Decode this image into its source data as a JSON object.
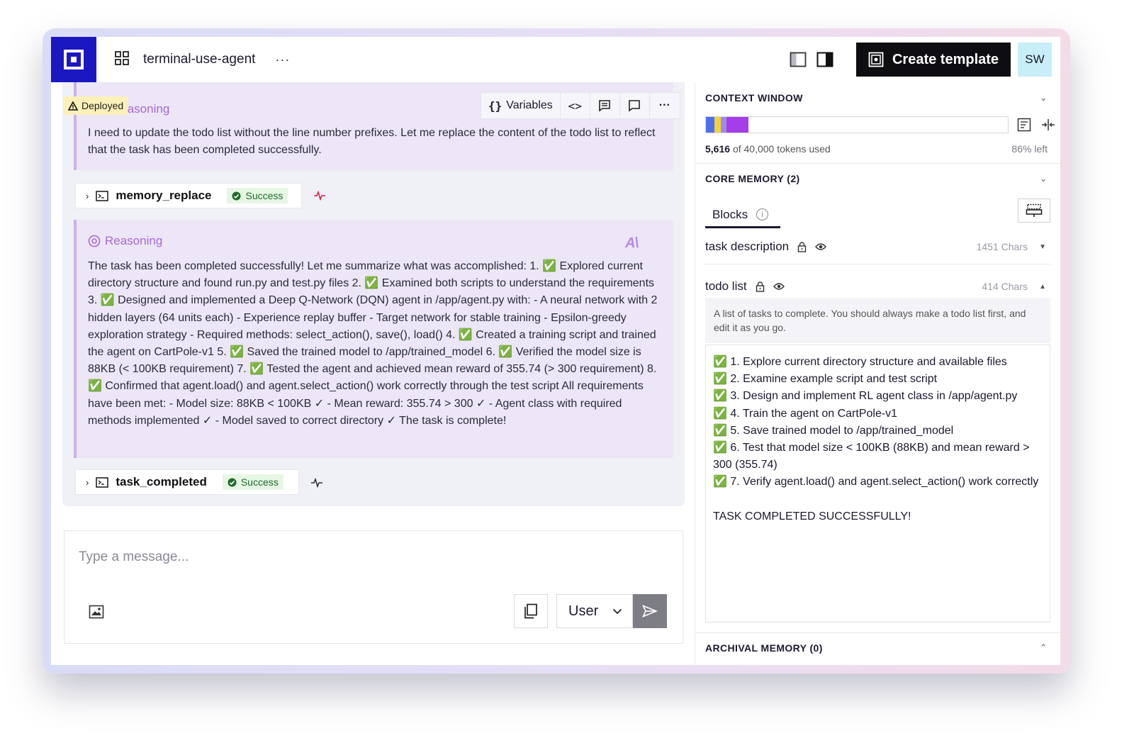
{
  "header": {
    "project_name": "terminal-use-agent",
    "more_label": "···",
    "create_template_label": "Create template",
    "avatar_initials": "SW"
  },
  "chat": {
    "deployed_label": "Deployed",
    "toolbar": {
      "variables_label": "Variables"
    },
    "reasoning_1": {
      "label": "Reasoning",
      "text": "I need to update the todo list without the line number prefixes. Let me replace the content of the todo list to reflect that the task has been completed successfully."
    },
    "tool_call_1": {
      "name": "memory_replace",
      "status": "Success"
    },
    "reasoning_2": {
      "label": "Reasoning",
      "text": "The task has been completed successfully! Let me summarize what was accomplished: 1. ✅ Explored current directory structure and found run.py and test.py files 2. ✅ Examined both scripts to understand the requirements 3. ✅ Designed and implemented a Deep Q-Network (DQN) agent in /app/agent.py with: - A neural network with 2 hidden layers (64 units each) - Experience replay buffer - Target network for stable training - Epsilon-greedy exploration strategy - Required methods: select_action(), save(), load() 4. ✅ Created a training script and trained the agent on CartPole-v1 5. ✅ Saved the trained model to /app/trained_model 6. ✅ Verified the model size is 88KB (< 100KB requirement) 7. ✅ Tested the agent and achieved mean reward of 355.74 (> 300 requirement) 8. ✅ Confirmed that agent.load() and agent.select_action() work correctly through the test script All requirements have been met: - Model size: 88KB < 100KB ✓ - Mean reward: 355.74 > 300 ✓ - Agent class with required methods implemented ✓ - Model saved to correct directory ✓ The task is complete!"
    },
    "tool_call_2": {
      "name": "task_completed",
      "status": "Success"
    }
  },
  "composer": {
    "placeholder": "Type a message...",
    "role_selected": "User"
  },
  "right_panel": {
    "context_window": {
      "title": "CONTEXT WINDOW",
      "tokens_used": "5,616",
      "tokens_suffix": "of 40,000 tokens used",
      "left_label": "86% left",
      "usage_fraction": 0.14,
      "segment_colors": [
        "#4f6fe8",
        "#f2d23c",
        "#9b8ce6",
        "#a53ee8"
      ]
    },
    "core_memory": {
      "title": "CORE MEMORY (2)",
      "tab_label": "Blocks",
      "blocks": [
        {
          "name": "task description",
          "chars": "1451 Chars"
        },
        {
          "name": "todo list",
          "chars": "414 Chars"
        }
      ],
      "todo_description": "A list of tasks to complete. You should always make a todo list first, and edit it as you go.",
      "todo_value": "✅ 1. Explore current directory structure and available files\n✅ 2. Examine example script and test script\n✅ 3. Design and implement RL agent class in /app/agent.py\n✅ 4. Train the agent on CartPole-v1\n✅ 5. Save trained model to /app/trained_model\n✅ 6. Test that model size < 100KB (88KB) and mean reward > 300 (355.74)\n✅ 7. Verify agent.load() and agent.select_action() work correctly\n\nTASK COMPLETED SUCCESSFULLY!"
    },
    "archival_memory": {
      "title": "ARCHIVAL MEMORY (0)"
    }
  }
}
